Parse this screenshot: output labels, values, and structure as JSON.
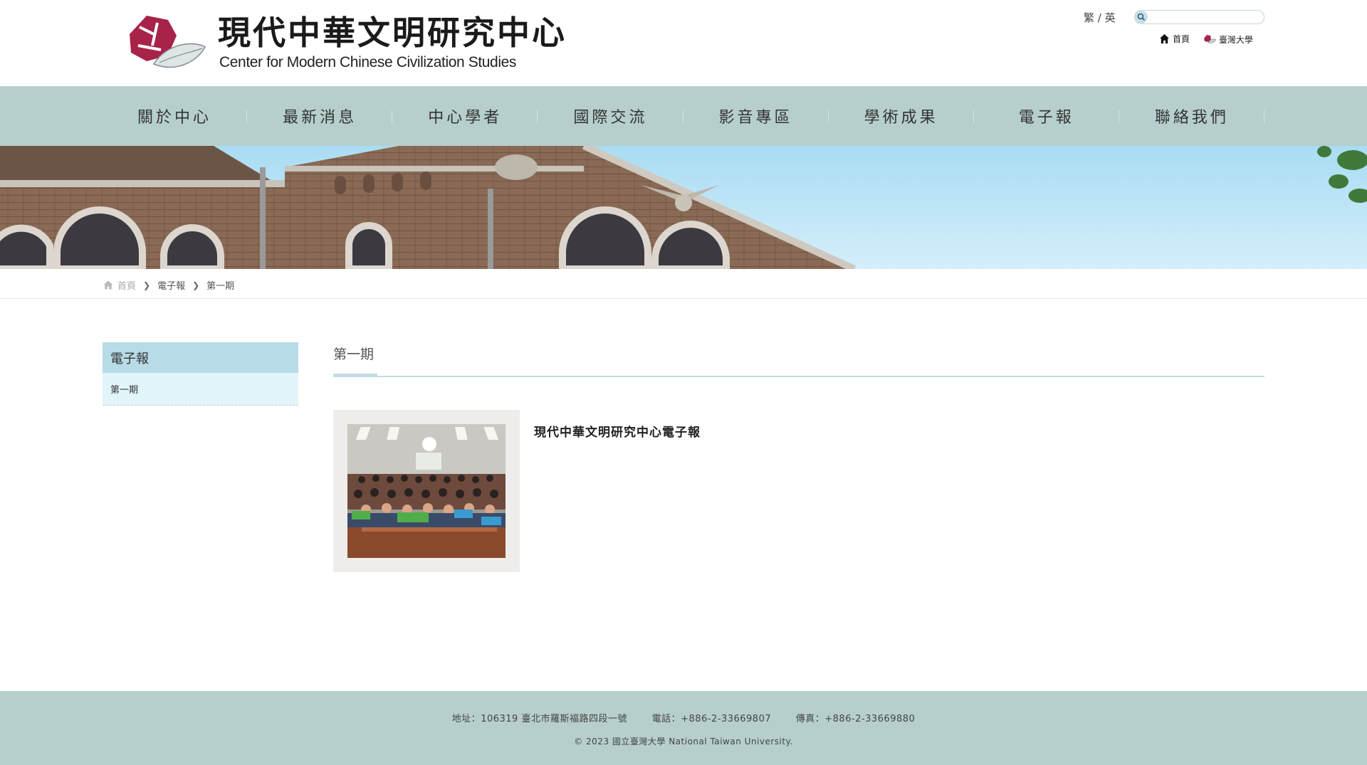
{
  "header": {
    "logo_cn": "現代中華文明研究中心",
    "logo_en": "Center for Modern Chinese Civilization Studies",
    "lang_zh": "繁",
    "lang_sep": " / ",
    "lang_en": "英",
    "search_placeholder": "",
    "home_link": "首頁",
    "ntu_link": "臺灣大學"
  },
  "nav": {
    "items": [
      "關於中心",
      "最新消息",
      "中心學者",
      "國際交流",
      "影音專區",
      "學術成果",
      "電子報",
      "聯絡我們"
    ]
  },
  "breadcrumb": {
    "home": "首頁",
    "level1": "電子報",
    "level2": "第一期"
  },
  "sidebar": {
    "title": "電子報",
    "items": [
      "第一期"
    ]
  },
  "main": {
    "title": "第一期",
    "card_title": "現代中華文明研究中心電子報"
  },
  "footer": {
    "address": "地址：106319 臺北市羅斯福路四段一號",
    "phone": "電話：+886-2-33669807",
    "fax": "傳真：+886-2-33669880",
    "copyright": "© 2023 國立臺灣大學 National Taiwan University."
  },
  "colors": {
    "nav_bg": "#b6cfcc",
    "sidebar_head": "#b7dbe7",
    "sidebar_item": "#e2f5fb",
    "footer_bg": "#b6cfcc",
    "logo_red": "#a8234a"
  },
  "icons": {
    "search": "search-icon",
    "home": "home-icon",
    "ntu": "ntu-logo-icon",
    "chevron": "chevron-right-icon"
  }
}
